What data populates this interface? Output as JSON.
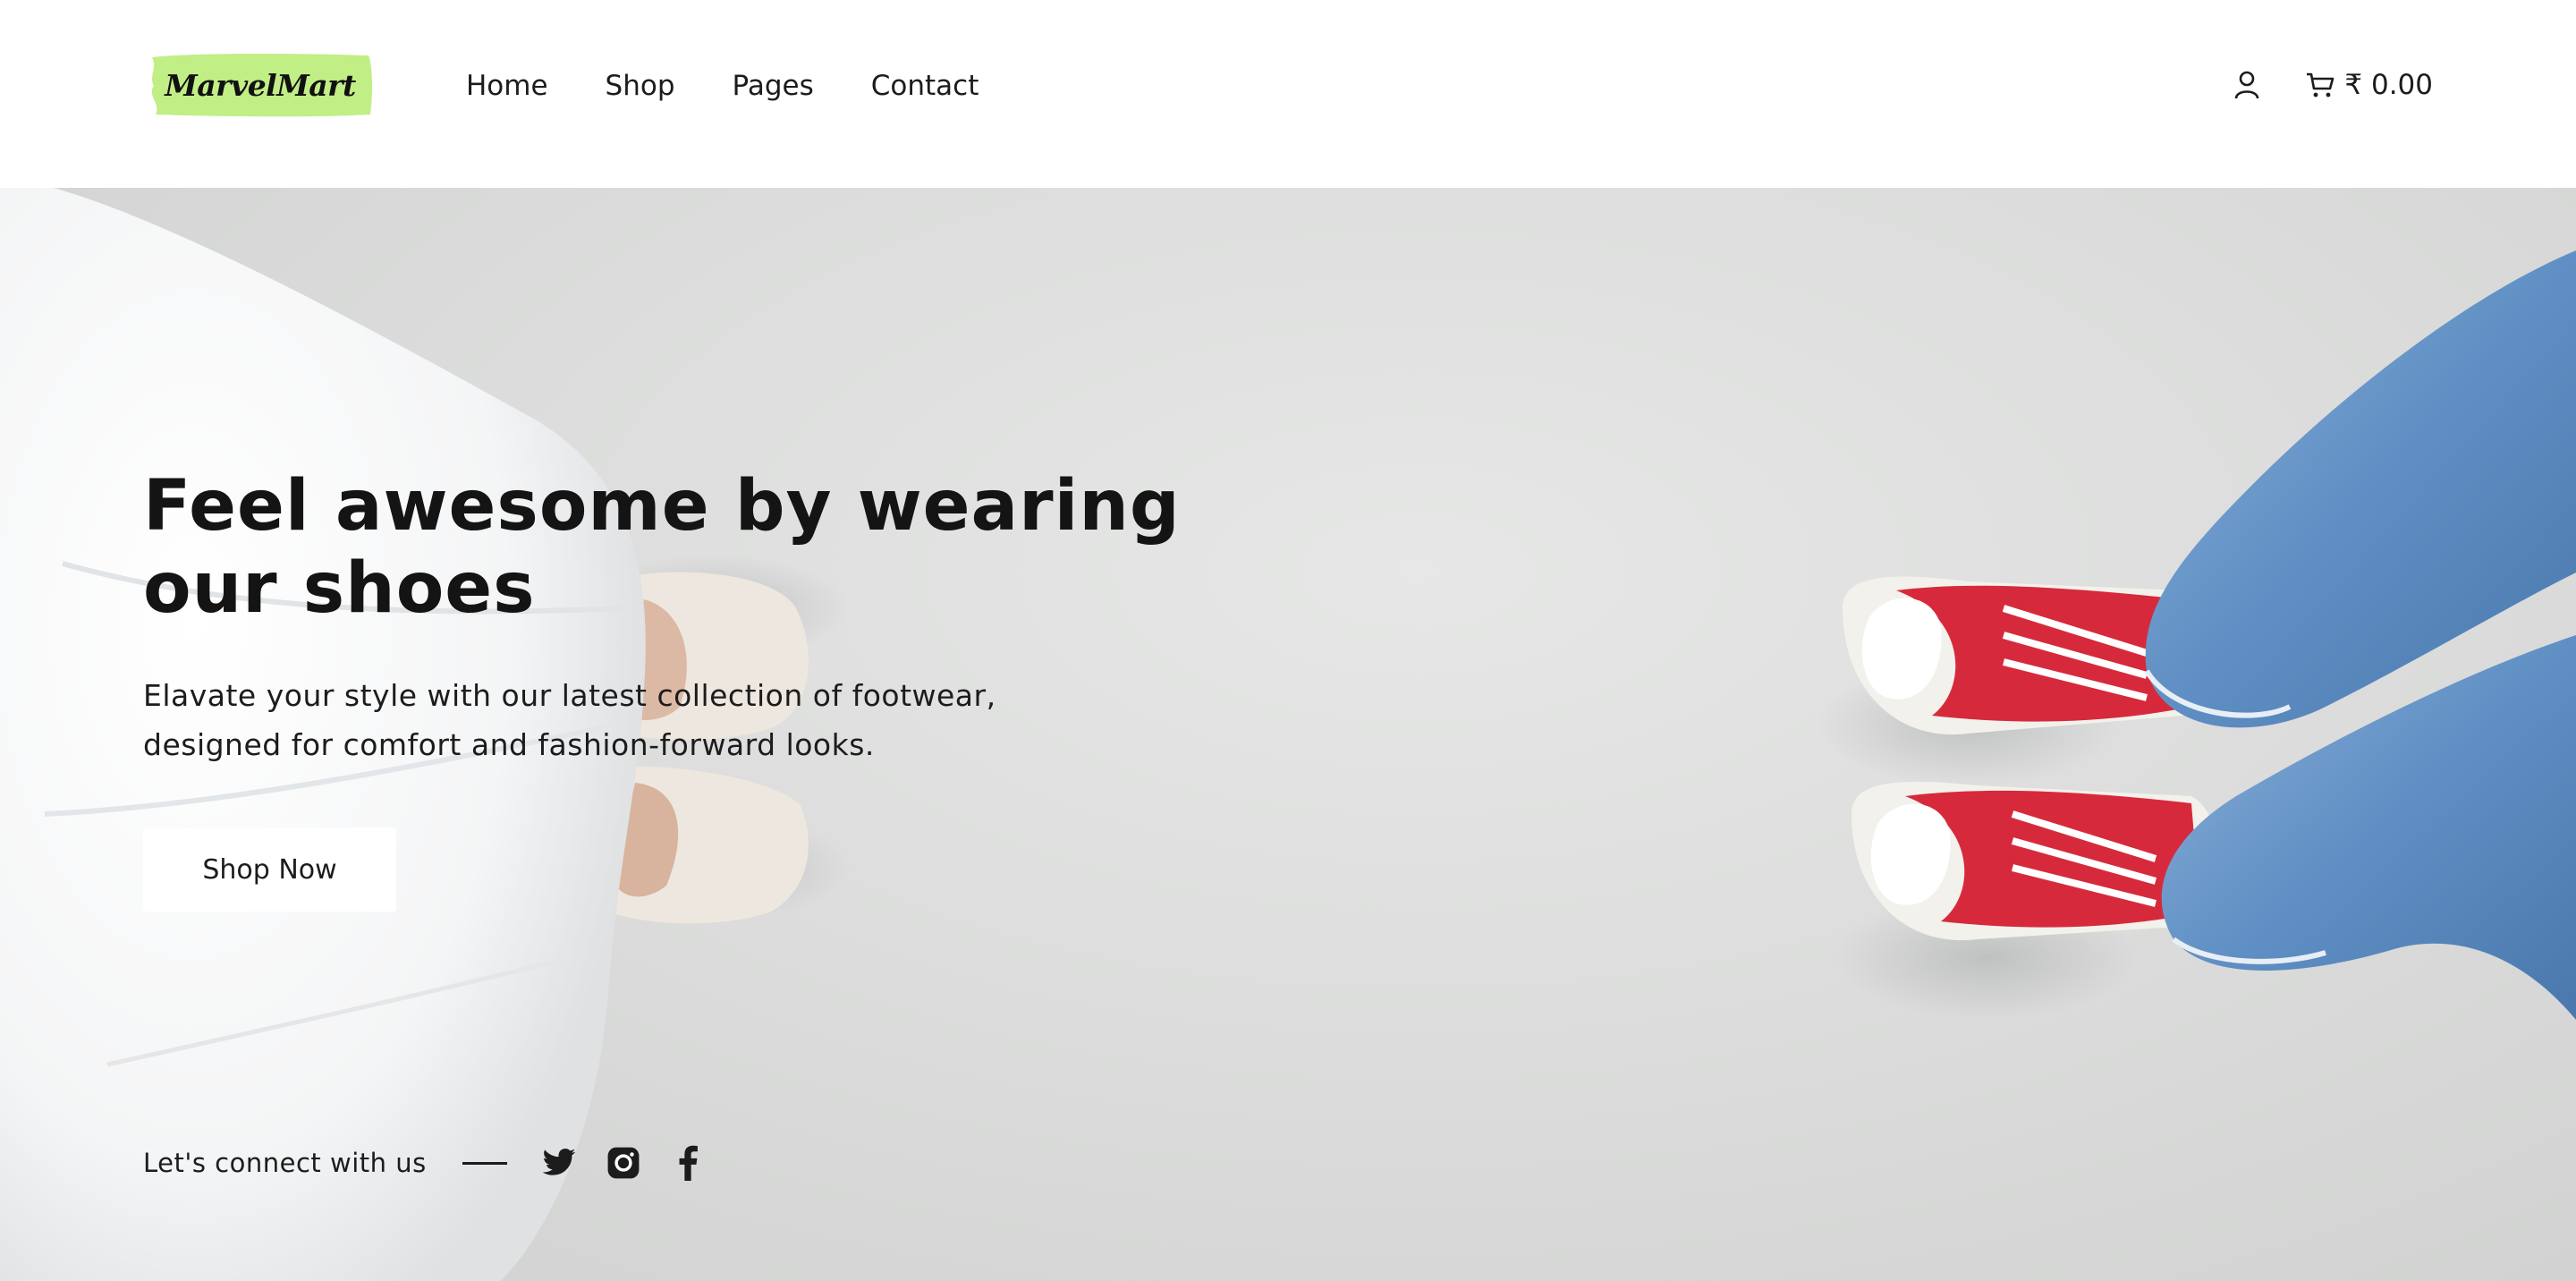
{
  "brand": {
    "name": "MarvelMart",
    "accent_color": "#c2ee86"
  },
  "nav": {
    "items": [
      {
        "label": "Home"
      },
      {
        "label": "Shop"
      },
      {
        "label": "Pages"
      },
      {
        "label": "Contact"
      }
    ]
  },
  "header": {
    "user_icon": "user-icon",
    "cart_icon": "cart-icon",
    "cart_total": "₹ 0.00"
  },
  "hero": {
    "title": "Feel awesome by wearing our shoes",
    "description": "Elavate your style with our latest collection of footwear, designed for comfort and fashion-forward looks.",
    "cta_label": "Shop Now"
  },
  "social": {
    "label": "Let's connect with us",
    "icons": [
      "twitter-icon",
      "instagram-icon",
      "facebook-icon"
    ]
  }
}
